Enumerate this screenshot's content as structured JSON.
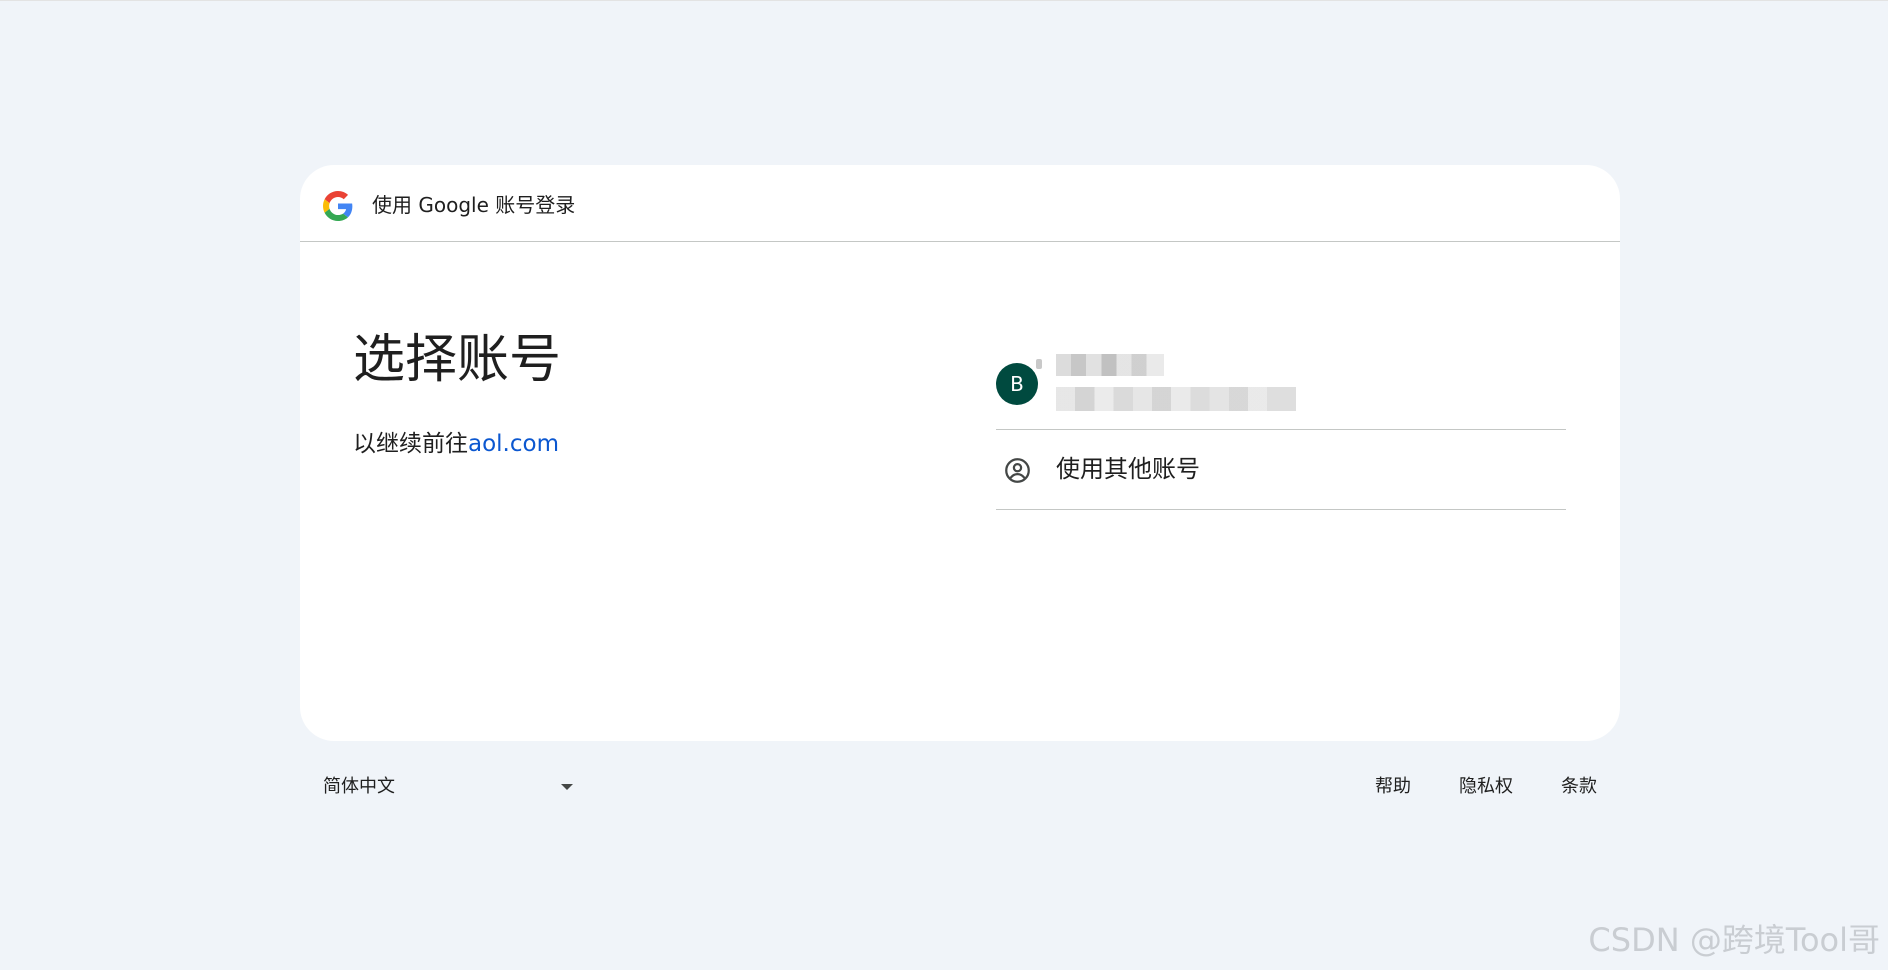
{
  "header": {
    "title": "使用 Google 账号登录",
    "logo_icon": "google-g-icon"
  },
  "main": {
    "title": "选择账号",
    "subtitle_prefix": "以继续前往",
    "subtitle_link": "aol.com"
  },
  "accounts": [
    {
      "avatar_letter": "B",
      "avatar_color": "#004a3f"
    }
  ],
  "other_account": {
    "label": "使用其他账号",
    "icon": "account-circle-icon"
  },
  "footer": {
    "language": "简体中文",
    "links": [
      "帮助",
      "隐私权",
      "条款"
    ]
  },
  "watermark": "CSDN @跨境Tool哥",
  "colors": {
    "background": "#f0f4f9",
    "card": "#ffffff",
    "link": "#0b57d0",
    "divider": "#c4c7c5"
  }
}
